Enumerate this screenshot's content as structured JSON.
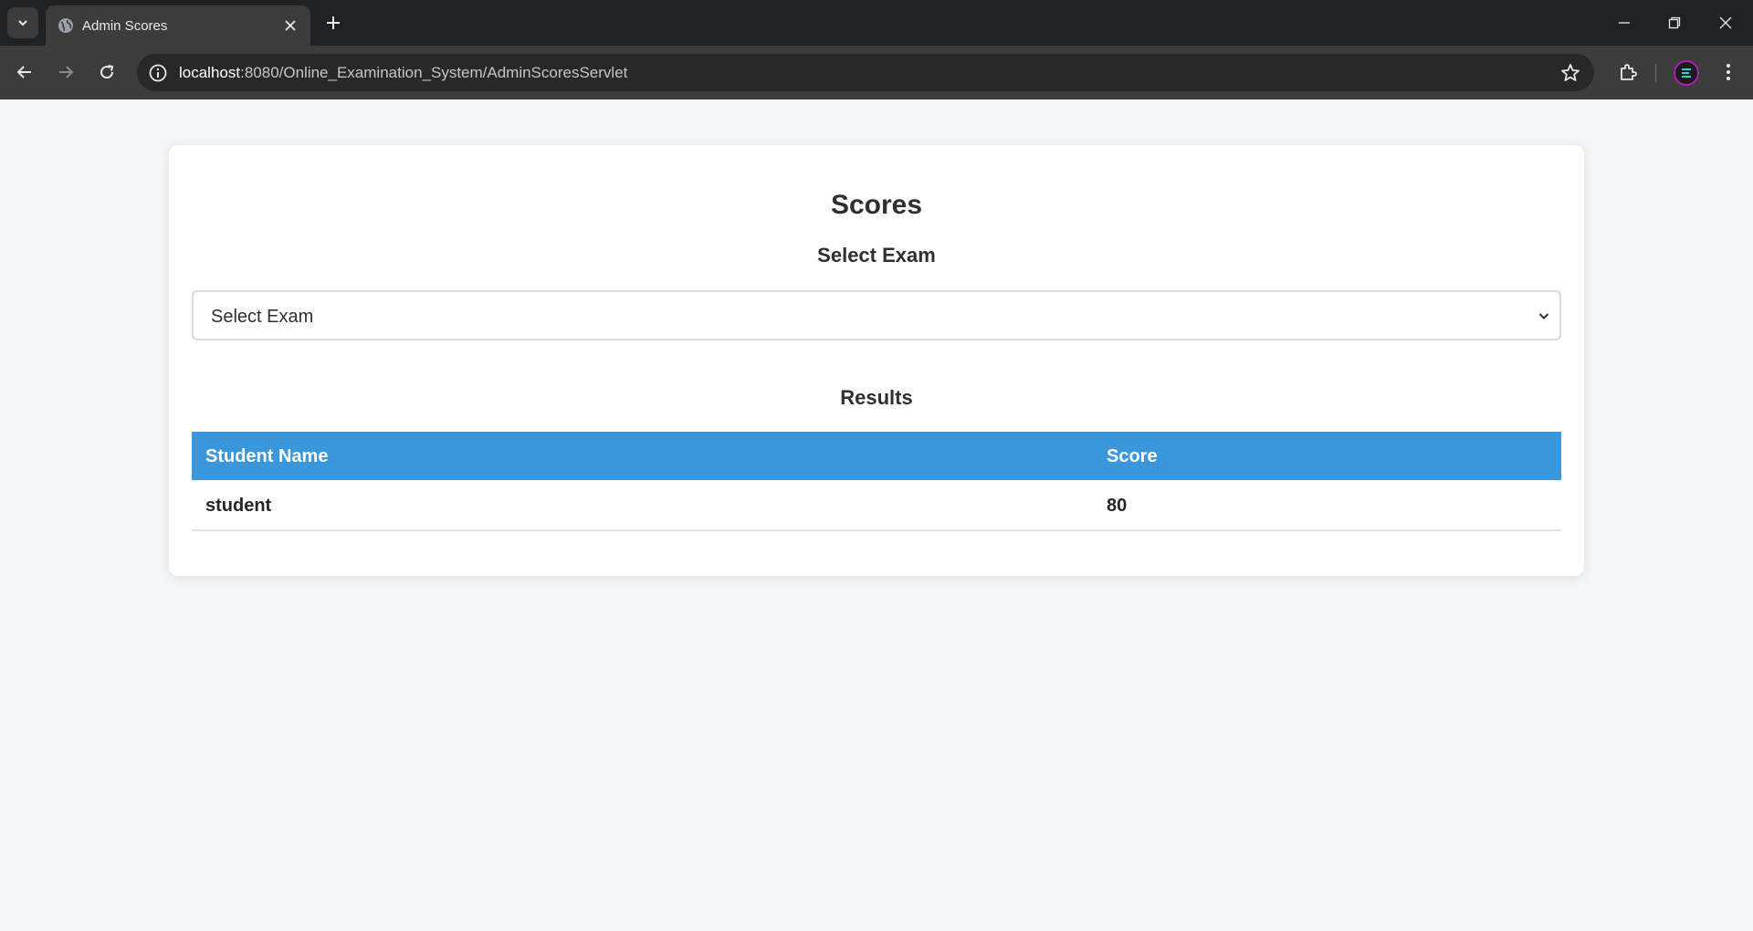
{
  "browser": {
    "tab_title": "Admin Scores",
    "url_host": "localhost",
    "url_path": ":8080/Online_Examination_System/AdminScoresServlet"
  },
  "page": {
    "title": "Scores",
    "select_heading": "Select Exam",
    "select_value": "Select Exam",
    "results_heading": "Results",
    "columns": [
      "Student Name",
      "Score"
    ],
    "rows": [
      {
        "name": "student",
        "score": "80"
      }
    ],
    "header_color": "#3b97db"
  }
}
